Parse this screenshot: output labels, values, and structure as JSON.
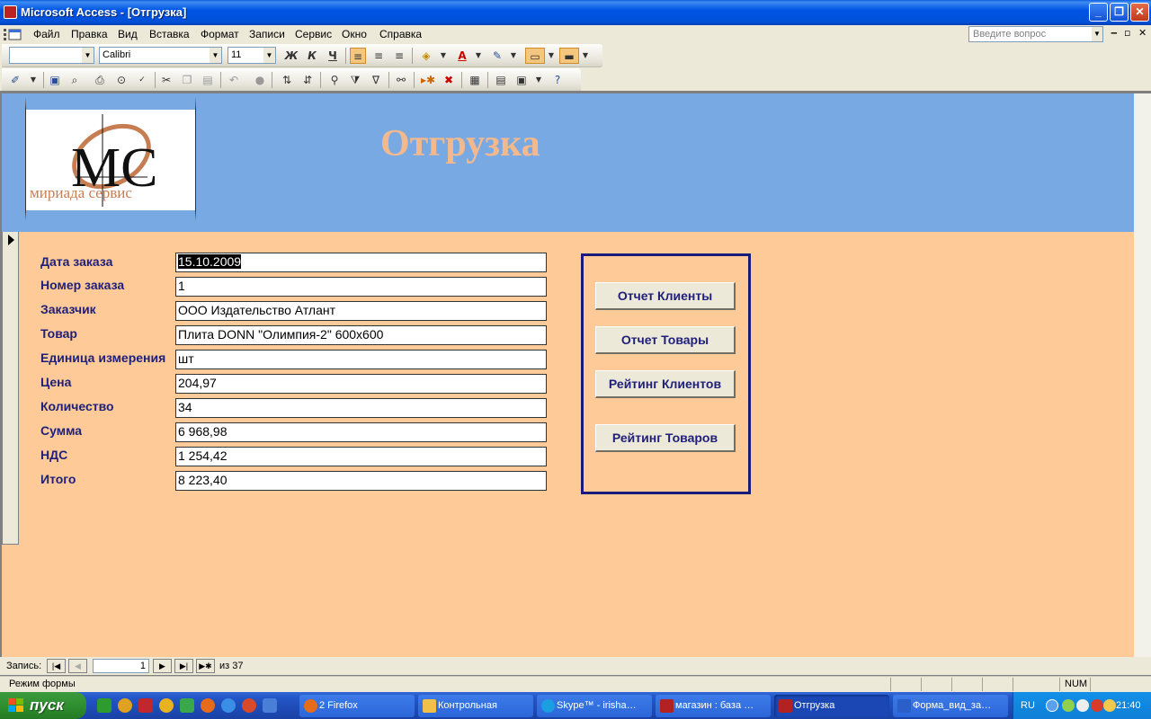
{
  "window": {
    "title": "Microsoft Access - [Отгрузка]",
    "min": "_",
    "max": "❐",
    "close": "✕"
  },
  "menu": {
    "items": [
      "Файл",
      "Правка",
      "Вид",
      "Вставка",
      "Формат",
      "Записи",
      "Сервис",
      "Окно",
      "Справка"
    ],
    "help_placeholder": "Введите вопрос"
  },
  "format_toolbar": {
    "object_select": "",
    "font": "Calibri",
    "size": "11",
    "bold": "Ж",
    "italic": "К",
    "underline": "Ч"
  },
  "form": {
    "title": "Отгрузка",
    "logo_text": "мириада сервис",
    "logo_letters": "МС",
    "fields": [
      {
        "label": "Дата заказа",
        "value": "15.10.2009"
      },
      {
        "label": "Номер заказа",
        "value": "1"
      },
      {
        "label": "Заказчик",
        "value": "ООО Издательство Атлант"
      },
      {
        "label": "Товар",
        "value": "Плита DONN \"Олимпия-2\"  600x600"
      },
      {
        "label": "Единица измерения",
        "value": "шт"
      },
      {
        "label": "Цена",
        "value": "204,97"
      },
      {
        "label": "Количество",
        "value": "34"
      },
      {
        "label": "Сумма",
        "value": "6 968,98"
      },
      {
        "label": "НДС",
        "value": "1 254,42"
      },
      {
        "label": "Итого",
        "value": "8 223,40"
      }
    ],
    "buttons": [
      "Отчет Клиенты",
      "Отчет Товары",
      "Рейтинг Клиентов",
      "Рейтинг Товаров"
    ]
  },
  "navigation": {
    "label": "Запись:",
    "current": "1",
    "of_label": "из",
    "total": "37"
  },
  "status": {
    "mode": "Режим формы",
    "num": "NUM"
  },
  "taskbar": {
    "start": "пуск",
    "tasks": [
      {
        "label": "2 Firefox",
        "color": "#e66b1b"
      },
      {
        "label": "Контрольная",
        "color": "#f0c04a"
      },
      {
        "label": "Skype™ - irisha…",
        "color": "#1a9fe0"
      },
      {
        "label": "магазин : база …",
        "color": "#b22222"
      },
      {
        "label": "Отгрузка",
        "color": "#b22222"
      },
      {
        "label": "Форма_вид_за…",
        "color": "#2a5fc9"
      }
    ],
    "lang": "RU",
    "clock": "21:40"
  }
}
